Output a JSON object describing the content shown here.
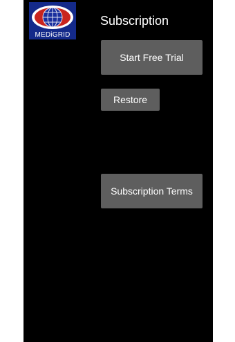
{
  "app": {
    "logo_text": "MEDiGRID"
  },
  "header": {
    "title": "Subscription"
  },
  "actions": {
    "start_trial_label": "Start Free Trial",
    "restore_label": "Restore",
    "terms_label": "Subscription Terms"
  },
  "colors": {
    "background": "#000000",
    "button_bg": "#5e5e5e",
    "text": "#ffffff",
    "logo_bg": "#142a8a"
  }
}
